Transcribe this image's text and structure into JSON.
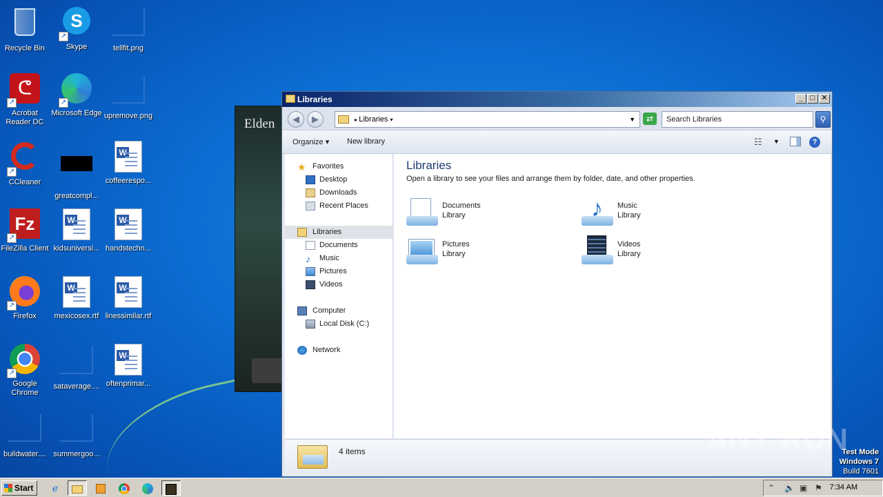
{
  "desktop": {
    "icons": [
      {
        "label": "Recycle Bin"
      },
      {
        "label": "Skype"
      },
      {
        "label": "tellfit.png"
      },
      {
        "label": "Acrobat Reader DC"
      },
      {
        "label": "Microsoft Edge"
      },
      {
        "label": "upremove.png"
      },
      {
        "label": "CCleaner"
      },
      {
        "label": "greatcompl..."
      },
      {
        "label": "coffeerespo..."
      },
      {
        "label": "FileZilla Client"
      },
      {
        "label": "kidsuniversi..."
      },
      {
        "label": "handstechn..."
      },
      {
        "label": "Firefox"
      },
      {
        "label": "mexicosex.rtf"
      },
      {
        "label": "linessimilar.rtf"
      },
      {
        "label": "Google Chrome"
      },
      {
        "label": "sataverage...."
      },
      {
        "label": "oftenprimar..."
      },
      {
        "label": "buildwater...."
      },
      {
        "label": "summergoo..."
      }
    ]
  },
  "background_window": {
    "title": "Elden"
  },
  "explorer": {
    "title": "Libraries",
    "address": "Libraries",
    "search_placeholder": "Search Libraries",
    "toolbar": {
      "organize": "Organize",
      "new_library": "New library"
    },
    "nav": {
      "favorites": "Favorites",
      "desktop": "Desktop",
      "downloads": "Downloads",
      "recent": "Recent Places",
      "libraries": "Libraries",
      "documents": "Documents",
      "music": "Music",
      "pictures": "Pictures",
      "videos": "Videos",
      "computer": "Computer",
      "local_disk": "Local Disk (C:)",
      "network": "Network"
    },
    "content": {
      "heading": "Libraries",
      "subheading": "Open a library to see your files and arrange them by folder, date, and other properties.",
      "libraries": [
        {
          "name": "Documents",
          "type": "Library"
        },
        {
          "name": "Music",
          "type": "Library"
        },
        {
          "name": "Pictures",
          "type": "Library"
        },
        {
          "name": "Videos",
          "type": "Library"
        }
      ]
    },
    "details": {
      "count": "4 items"
    }
  },
  "taskbar": {
    "start": "Start",
    "time": "7:34 AM"
  },
  "watermark": "ANY RUN",
  "test_mode": {
    "line1": "Test Mode",
    "line2": "Windows 7",
    "line3": "Build 7601"
  }
}
